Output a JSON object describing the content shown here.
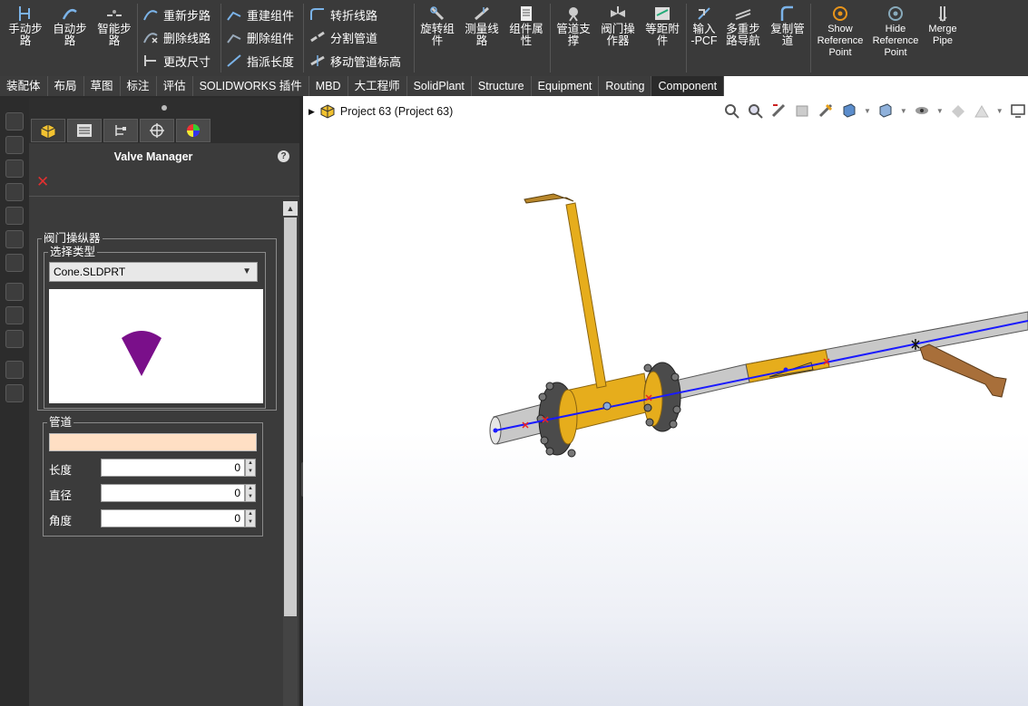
{
  "ribbon": {
    "big_buttons": [
      {
        "id": "manual-route",
        "label": "手动步\n路"
      },
      {
        "id": "auto-route",
        "label": "自动步\n路"
      },
      {
        "id": "smart-route",
        "label": "智能步\n路"
      },
      {
        "id": "rotate-comp",
        "label": "旋转组\n件"
      },
      {
        "id": "measure-route",
        "label": "测量线\n路"
      },
      {
        "id": "comp-props",
        "label": "组件属\n性"
      },
      {
        "id": "pipe-support",
        "label": "管道支\n撑"
      },
      {
        "id": "valve-op",
        "label": "阀门操\n作器"
      },
      {
        "id": "equal-spacing",
        "label": "等距附\n件"
      },
      {
        "id": "import-pcf",
        "label": "输入\n-PCF"
      },
      {
        "id": "multi-route-nav",
        "label": "多重步\n路导航"
      },
      {
        "id": "copy-pipe",
        "label": "复制管\n道"
      },
      {
        "id": "show-ref",
        "label": "Show\nReference\nPoint"
      },
      {
        "id": "hide-ref",
        "label": "Hide\nReference\nPoint"
      },
      {
        "id": "merge-pipe",
        "label": "Merge\nPipe"
      }
    ],
    "small_buttons": [
      {
        "id": "restep",
        "label": "重新步路"
      },
      {
        "id": "delete-route",
        "label": "删除线路"
      },
      {
        "id": "change-size",
        "label": "更改尺寸"
      },
      {
        "id": "rebuild-comp",
        "label": "重建组件"
      },
      {
        "id": "delete-comp",
        "label": "删除组件"
      },
      {
        "id": "assign-length",
        "label": "指派长度"
      },
      {
        "id": "bend-route",
        "label": "转折线路"
      },
      {
        "id": "split-pipe",
        "label": "分割管道"
      },
      {
        "id": "move-elevation",
        "label": "移动管道标高"
      }
    ]
  },
  "tabs": [
    "装配体",
    "布局",
    "草图",
    "标注",
    "评估",
    "SOLIDWORKS 插件",
    "MBD",
    "大工程师",
    "SolidPlant",
    "Structure",
    "Equipment",
    "Routing",
    "Component"
  ],
  "active_tab": "Component",
  "panel": {
    "title": "Valve Manager",
    "help": "?",
    "close": "✕",
    "operator_group": "阀门操纵器",
    "select_type_group": "选择类型",
    "select_value": "Cone.SLDPRT",
    "preview_color": "#7a0f8a",
    "pipe_group": "管道",
    "pipe_color": "#ffdfc4",
    "fields": [
      {
        "label": "长度",
        "value": "0"
      },
      {
        "label": "直径",
        "value": "0"
      },
      {
        "label": "角度",
        "value": "0"
      }
    ]
  },
  "viewport": {
    "tree_label": "Project 63  (Project 63)",
    "route_color": "#1a1aff",
    "pipe_color": "#c8c8c8",
    "valve_color": "#e6ad1c"
  }
}
